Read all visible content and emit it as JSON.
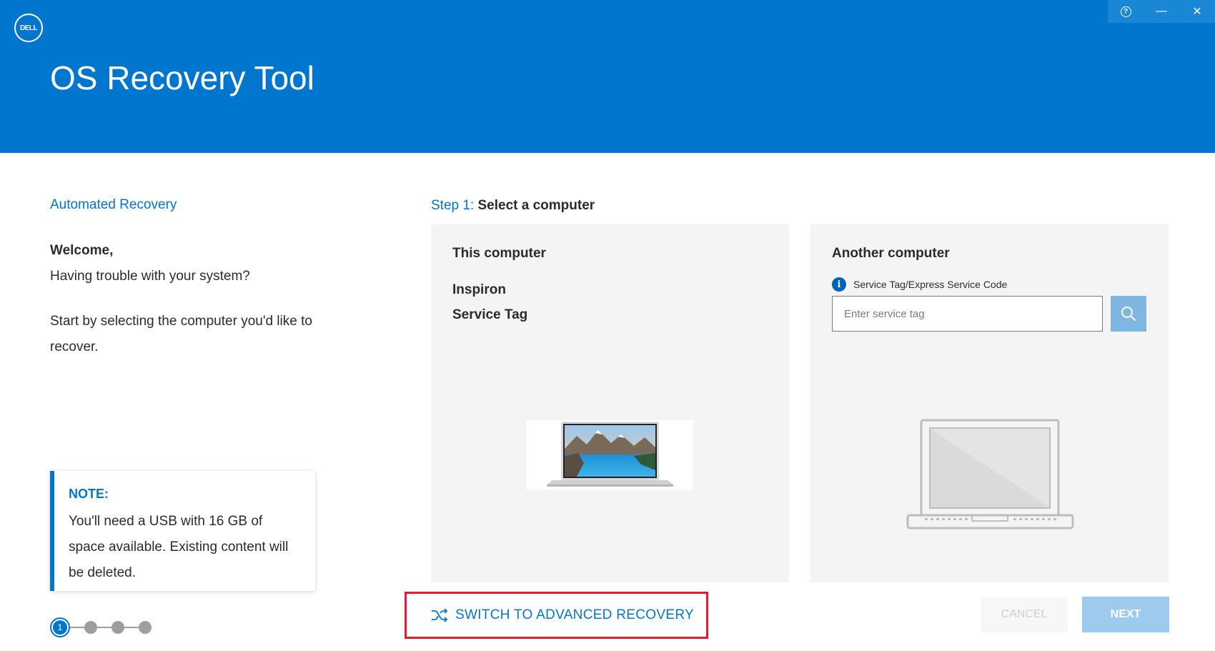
{
  "header": {
    "logo_text": "DELL",
    "app_title": "OS Recovery Tool",
    "window_controls": {
      "help_icon": "help-icon",
      "help_glyph": "?",
      "minimize_glyph": "—",
      "close_glyph": "✕"
    }
  },
  "left": {
    "mode_title": "Automated Recovery",
    "welcome": "Welcome,",
    "trouble": "Having trouble with your system?",
    "instructions": "Start by selecting the computer you'd like to recover.",
    "note": {
      "title": "NOTE:",
      "text": "You'll need a USB with 16 GB of space available. Existing content will be deleted."
    },
    "stepper": {
      "current": "1",
      "total_steps": 4
    }
  },
  "step": {
    "number": "Step 1:",
    "text": "Select a computer"
  },
  "this_computer": {
    "title": "This computer",
    "model": "Inspiron",
    "service_tag_label": "Service Tag"
  },
  "another_computer": {
    "title": "Another computer",
    "field_label": "Service Tag/Express Service Code",
    "placeholder": "Enter service tag",
    "value": ""
  },
  "actions": {
    "advanced": "SWITCH TO ADVANCED RECOVERY",
    "cancel": "CANCEL",
    "next": "NEXT"
  },
  "colors": {
    "brand_blue": "#0076ce",
    "highlight_red": "#e0202c",
    "panel_bg": "#f4f4f4"
  }
}
